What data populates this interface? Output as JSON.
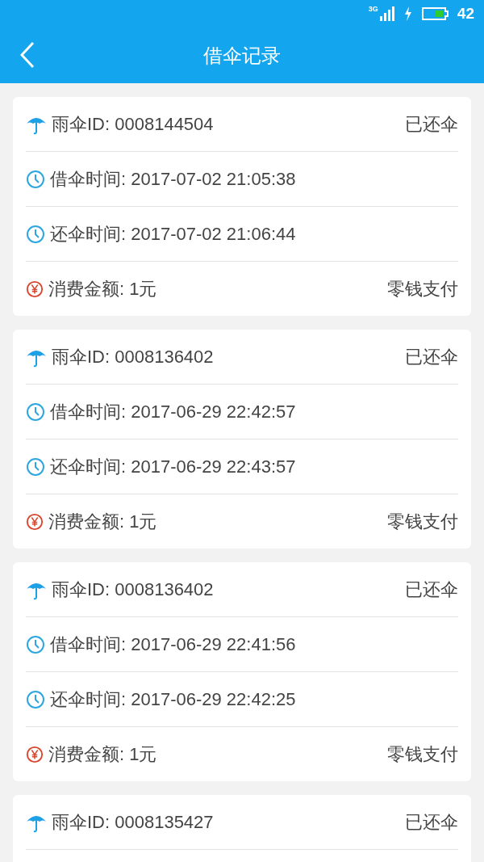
{
  "status_bar": {
    "network": "3G",
    "battery": "42"
  },
  "header": {
    "title": "借伞记录"
  },
  "records": [
    {
      "rows": [
        {
          "kind": "umbrella",
          "text": "雨伞ID: 0008144504",
          "right": "已还伞"
        },
        {
          "kind": "clock",
          "text": "借伞时间: 2017-07-02 21:05:38"
        },
        {
          "kind": "clock",
          "text": "还伞时间: 2017-07-02 21:06:44"
        },
        {
          "kind": "money",
          "text": "消费金额: 1元",
          "right": "零钱支付"
        }
      ]
    },
    {
      "rows": [
        {
          "kind": "umbrella",
          "text": "雨伞ID: 0008136402",
          "right": "已还伞"
        },
        {
          "kind": "clock",
          "text": "借伞时间: 2017-06-29 22:42:57"
        },
        {
          "kind": "clock",
          "text": "还伞时间: 2017-06-29 22:43:57"
        },
        {
          "kind": "money",
          "text": "消费金额: 1元",
          "right": "零钱支付"
        }
      ]
    },
    {
      "rows": [
        {
          "kind": "umbrella",
          "text": "雨伞ID: 0008136402",
          "right": "已还伞"
        },
        {
          "kind": "clock",
          "text": "借伞时间: 2017-06-29 22:41:56"
        },
        {
          "kind": "clock",
          "text": "还伞时间: 2017-06-29 22:42:25"
        },
        {
          "kind": "money",
          "text": "消费金额: 1元",
          "right": "零钱支付"
        }
      ]
    },
    {
      "rows": [
        {
          "kind": "umbrella",
          "text": "雨伞ID: 0008135427",
          "right": "已还伞"
        }
      ]
    }
  ]
}
